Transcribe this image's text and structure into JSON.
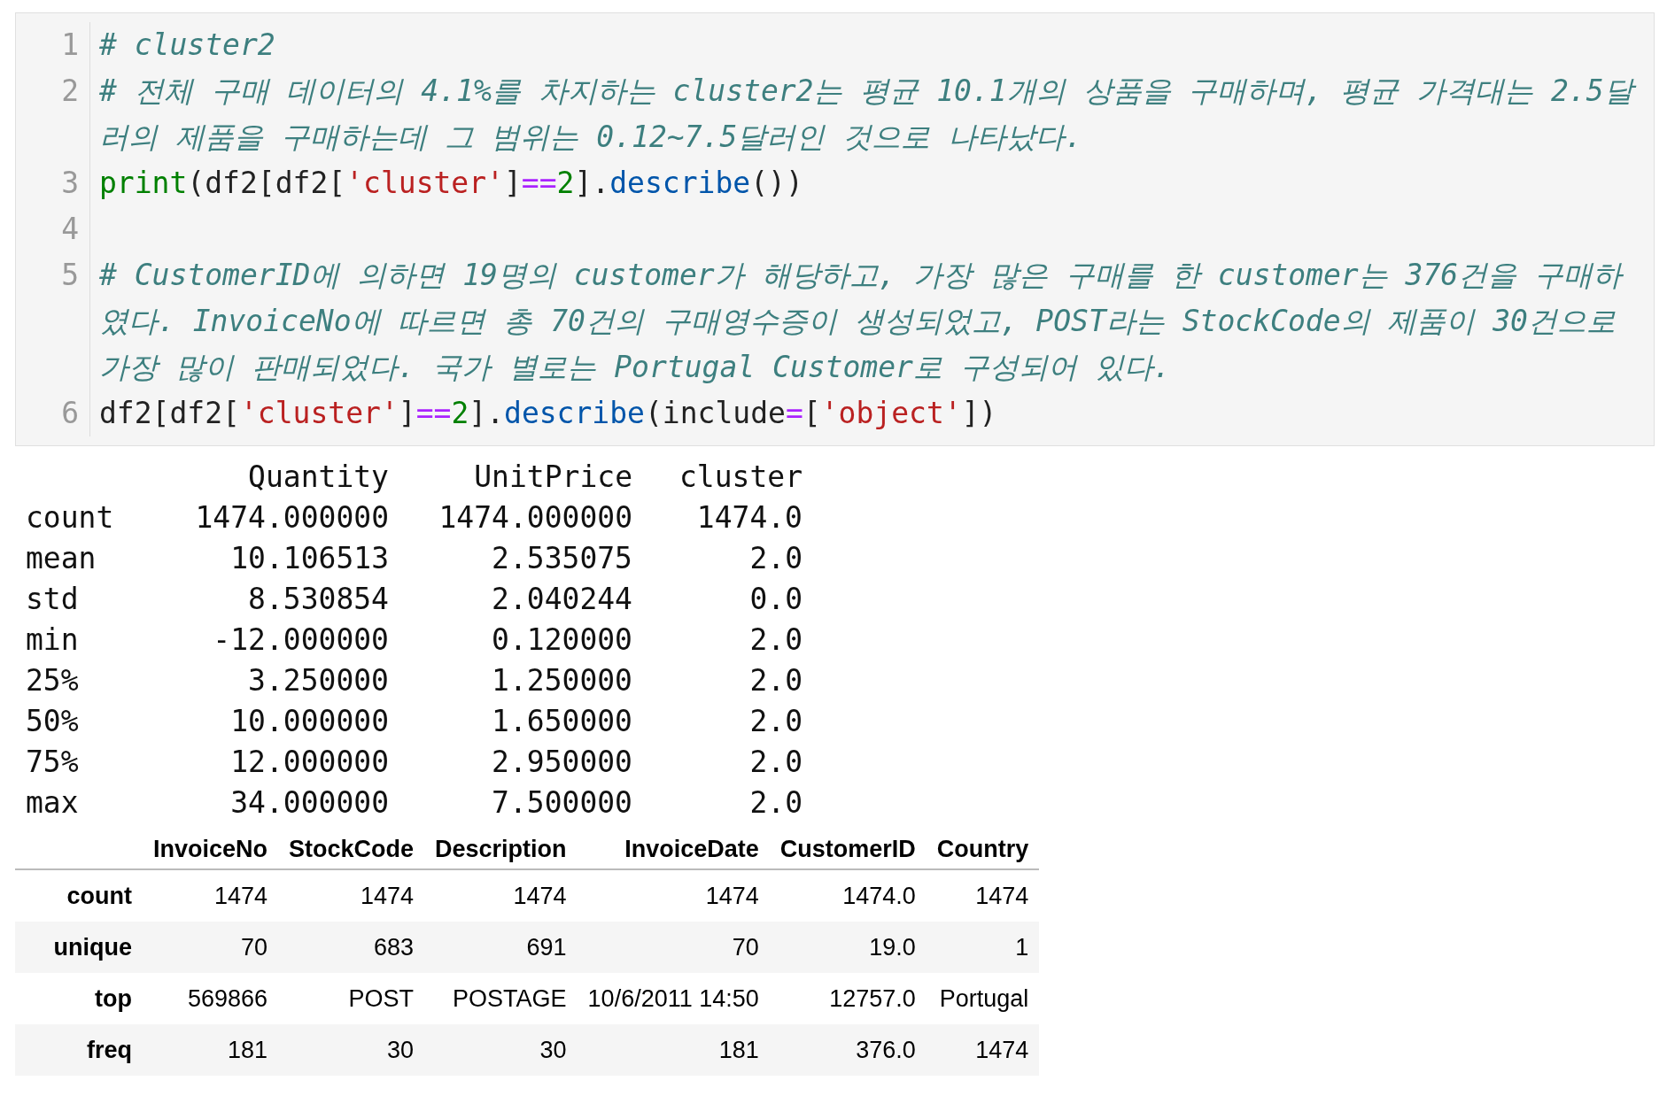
{
  "code_cell": {
    "lines": [
      {
        "number": "1",
        "tokens": [
          {
            "kind": "comment",
            "text": "# cluster2"
          }
        ]
      },
      {
        "number": "2",
        "tokens": [
          {
            "kind": "comment",
            "text": "# 전체 구매 데이터의 4.1%를 차지하는 cluster2는 평균 10.1개의 상품을 구매하며, 평균 가격대는 2.5달러의 제품을 구매하는데 그 범위는 0.12~7.5달러인 것으로 나타났다."
          }
        ]
      },
      {
        "number": "3",
        "tokens": [
          {
            "kind": "builtin",
            "text": "print"
          },
          {
            "kind": "plain",
            "text": "(df2[df2["
          },
          {
            "kind": "string",
            "text": "'cluster'"
          },
          {
            "kind": "plain",
            "text": "]"
          },
          {
            "kind": "operator",
            "text": "=="
          },
          {
            "kind": "number",
            "text": "2"
          },
          {
            "kind": "plain",
            "text": "]."
          },
          {
            "kind": "method",
            "text": "describe"
          },
          {
            "kind": "plain",
            "text": "())"
          }
        ]
      },
      {
        "number": "4"
      },
      {
        "number": "5",
        "tokens": [
          {
            "kind": "comment",
            "text": "# CustomerID에 의하면 19명의 customer가 해당하고, 가장 많은 구매를 한 customer는 376건을 구매하였다. InvoiceNo에 따르면 총 70건의 구매영수증이 생성되었고, POST라는 StockCode의 제품이 30건으로 가장 많이 판매되었다. 국가 별로는 Portugal Customer로 구성되어 있다."
          }
        ]
      },
      {
        "number": "6",
        "tokens": [
          {
            "kind": "plain",
            "text": "df2[df2["
          },
          {
            "kind": "string",
            "text": "'cluster'"
          },
          {
            "kind": "plain",
            "text": "]"
          },
          {
            "kind": "operator",
            "text": "=="
          },
          {
            "kind": "number",
            "text": "2"
          },
          {
            "kind": "plain",
            "text": "]."
          },
          {
            "kind": "method",
            "text": "describe"
          },
          {
            "kind": "plain",
            "text": "(include"
          },
          {
            "kind": "operator",
            "text": "="
          },
          {
            "kind": "plain",
            "text": "["
          },
          {
            "kind": "string",
            "text": "'object'"
          },
          {
            "kind": "plain",
            "text": "])"
          }
        ]
      }
    ]
  },
  "text_output": {
    "columns": [
      "Quantity",
      "UnitPrice",
      "cluster"
    ],
    "rows": [
      {
        "label": "count",
        "values": [
          "1474.000000",
          "1474.000000",
          "1474.0"
        ]
      },
      {
        "label": "mean",
        "values": [
          "10.106513",
          "2.535075",
          "2.0"
        ]
      },
      {
        "label": "std",
        "values": [
          "8.530854",
          "2.040244",
          "0.0"
        ]
      },
      {
        "label": "min",
        "values": [
          "-12.000000",
          "0.120000",
          "2.0"
        ]
      },
      {
        "label": "25%",
        "values": [
          "3.250000",
          "1.250000",
          "2.0"
        ]
      },
      {
        "label": "50%",
        "values": [
          "10.000000",
          "1.650000",
          "2.0"
        ]
      },
      {
        "label": "75%",
        "values": [
          "12.000000",
          "2.950000",
          "2.0"
        ]
      },
      {
        "label": "max",
        "values": [
          "34.000000",
          "7.500000",
          "2.0"
        ]
      }
    ]
  },
  "table": {
    "columns": [
      "InvoiceNo",
      "StockCode",
      "Description",
      "InvoiceDate",
      "CustomerID",
      "Country"
    ],
    "rows": [
      {
        "label": "count",
        "values": [
          "1474",
          "1474",
          "1474",
          "1474",
          "1474.0",
          "1474"
        ]
      },
      {
        "label": "unique",
        "values": [
          "70",
          "683",
          "691",
          "70",
          "19.0",
          "1"
        ]
      },
      {
        "label": "top",
        "values": [
          "569866",
          "POST",
          "POSTAGE",
          "10/6/2011 14:50",
          "12757.0",
          "Portugal"
        ]
      },
      {
        "label": "freq",
        "values": [
          "181",
          "30",
          "30",
          "181",
          "376.0",
          "1474"
        ]
      }
    ]
  }
}
